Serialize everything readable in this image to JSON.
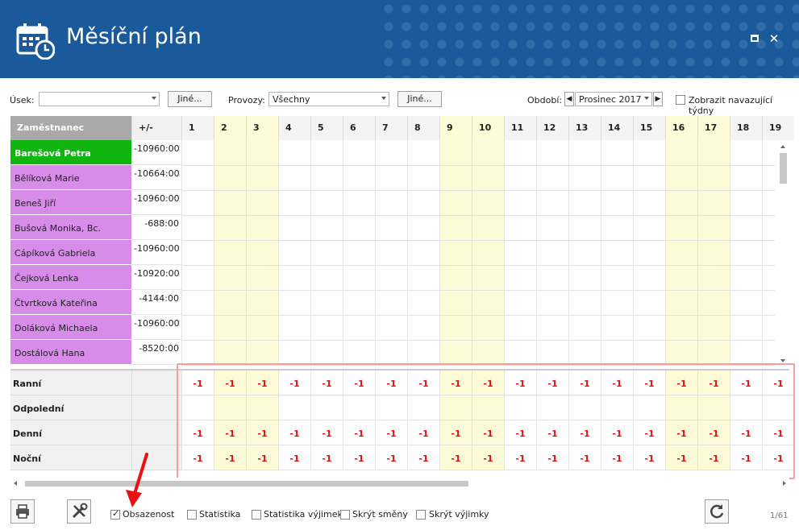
{
  "window": {
    "title": "Měsíční plán"
  },
  "icons": {
    "calendar": "calendar-clock-icon",
    "maximize": "maximize-icon",
    "close": "close-icon",
    "print": "print-icon",
    "tools": "tools-icon",
    "refresh": "refresh-icon"
  },
  "filters": {
    "usek_label": "Úsek:",
    "usek_value": "",
    "usek_other": "Jiné...",
    "provozy_label": "Provozy:",
    "provozy_value": "Všechny",
    "provozy_other": "Jiné...",
    "obdobi_label": "Období:",
    "obdobi_value": "Prosinec 2017",
    "show_weeks_label": "Zobrazit navazující týdny",
    "show_weeks_checked": false
  },
  "grid": {
    "col_employee": "Zaměstnanec",
    "col_balance": "+/-",
    "days": [
      {
        "label": "1",
        "weekend": false
      },
      {
        "label": "2",
        "weekend": true
      },
      {
        "label": "3",
        "weekend": true
      },
      {
        "label": "4",
        "weekend": false
      },
      {
        "label": "5",
        "weekend": false
      },
      {
        "label": "6",
        "weekend": false
      },
      {
        "label": "7",
        "weekend": false
      },
      {
        "label": "8",
        "weekend": false
      },
      {
        "label": "9",
        "weekend": true
      },
      {
        "label": "10",
        "weekend": true
      },
      {
        "label": "11",
        "weekend": false
      },
      {
        "label": "12",
        "weekend": false
      },
      {
        "label": "13",
        "weekend": false
      },
      {
        "label": "14",
        "weekend": false
      },
      {
        "label": "15",
        "weekend": false
      },
      {
        "label": "16",
        "weekend": true
      },
      {
        "label": "17",
        "weekend": true
      },
      {
        "label": "18",
        "weekend": false
      },
      {
        "label": "19",
        "weekend": false
      }
    ],
    "employees": [
      {
        "name": "Barešová Petra",
        "balance": "-10960:00"
      },
      {
        "name": "Bělíková Marie",
        "balance": "-10664:00"
      },
      {
        "name": "Beneš Jiří",
        "balance": "-10960:00"
      },
      {
        "name": "Bušová Monika, Bc.",
        "balance": "-688:00"
      },
      {
        "name": "Cápíková Gabriela",
        "balance": "-10960:00"
      },
      {
        "name": "Čejková Lenka",
        "balance": "-10920:00"
      },
      {
        "name": "Čtvrtková Kateřina",
        "balance": "-4144:00"
      },
      {
        "name": "Doláková Michaela",
        "balance": "-10960:00"
      },
      {
        "name": "Dostálová Hana",
        "balance": "-8520:00"
      }
    ]
  },
  "summary": {
    "rows": [
      {
        "label": "Ranní",
        "value": "-1",
        "filled": true
      },
      {
        "label": "Odpolední",
        "value": "",
        "filled": false
      },
      {
        "label": "Denní",
        "value": "-1",
        "filled": true
      },
      {
        "label": "Noční",
        "value": "-1",
        "filled": true
      }
    ]
  },
  "footer": {
    "obsazenost_label": "Obsazenost",
    "obsazenost_checked": true,
    "statistika_label": "Statistika",
    "statistika_vyjimek_label": "Statistika výjimek",
    "skryt_smeny_label": "Skrýt směny",
    "skryt_vyjimky_label": "Skrýt výjimky",
    "page_counter": "1/61"
  }
}
